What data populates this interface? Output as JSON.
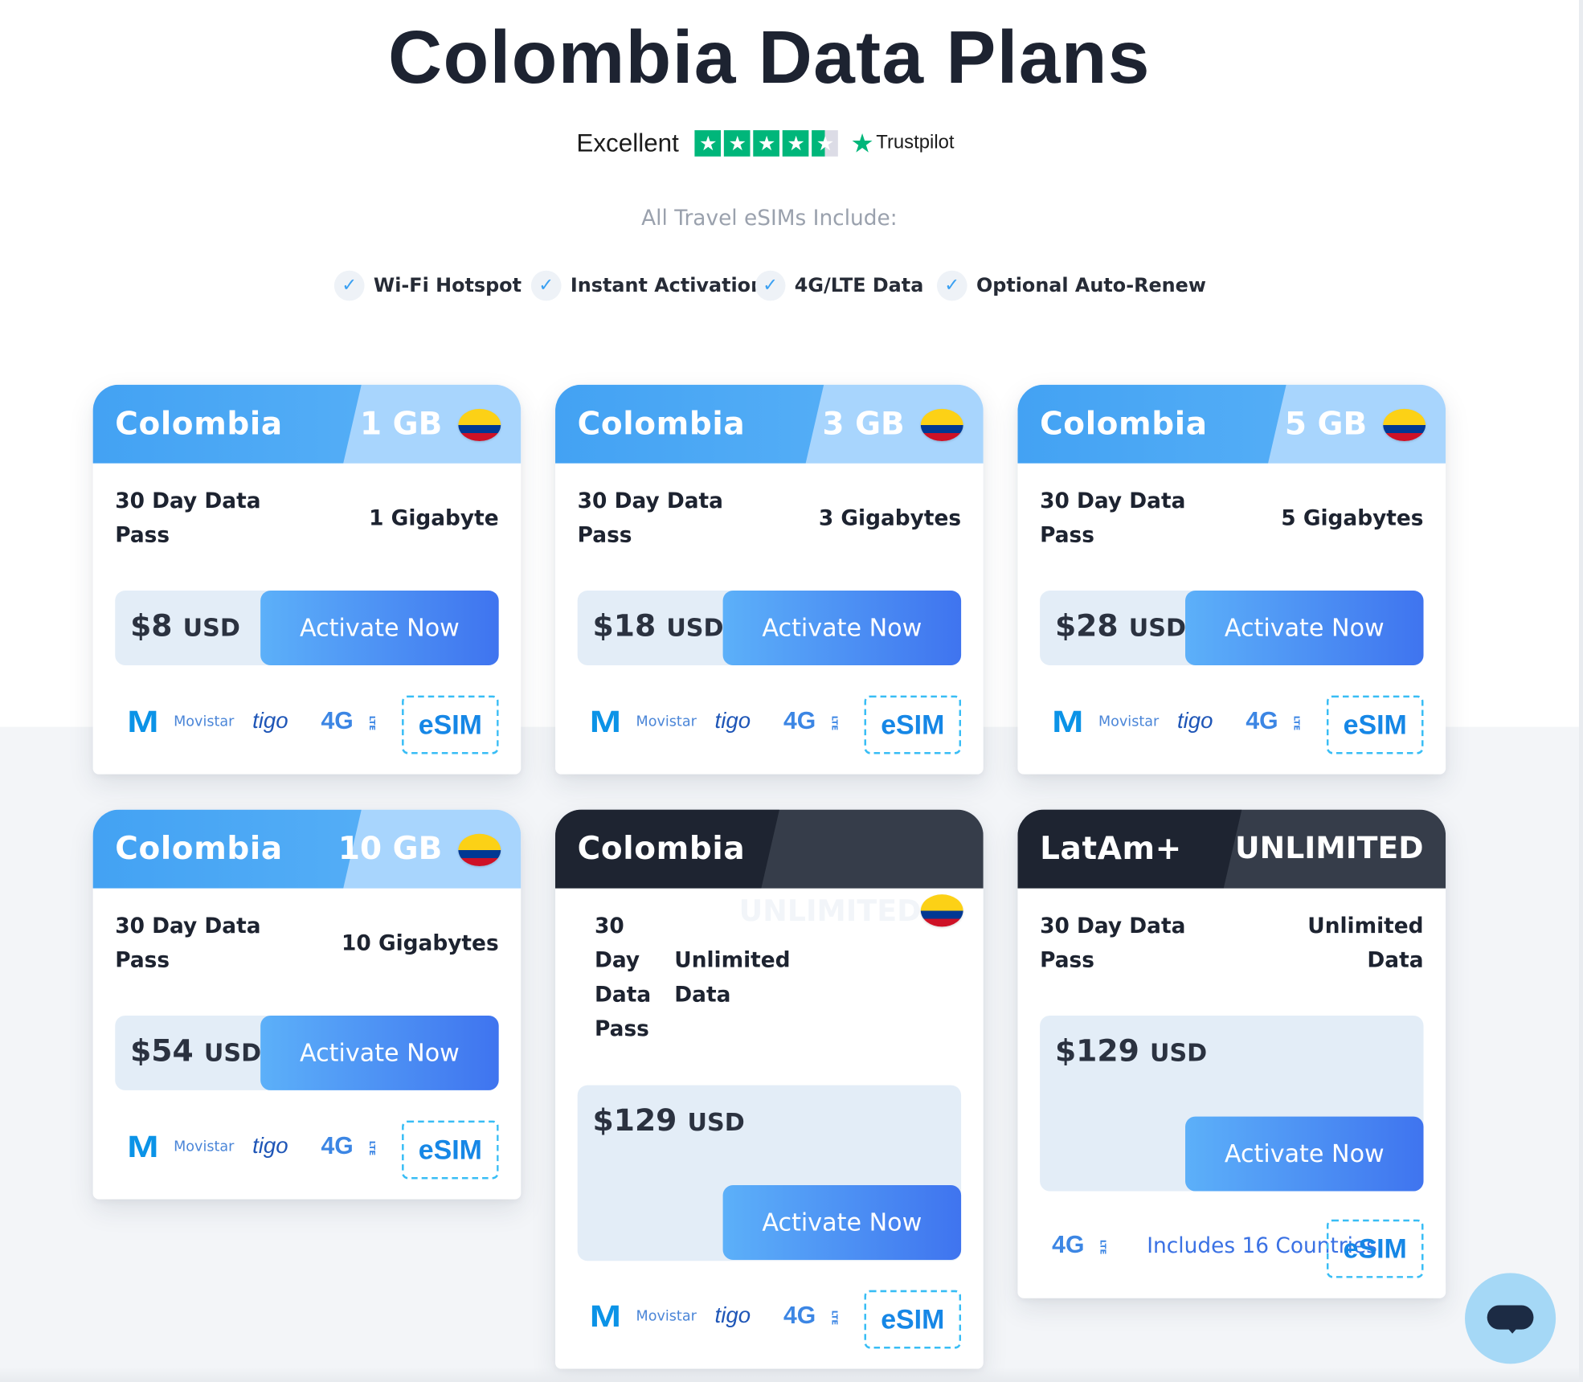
{
  "page": {
    "title": "Colombia Data Plans",
    "rating_label": "Excellent",
    "rating_stars": 4.5,
    "trustpilot": "Trustpilot",
    "includes_heading": "All Travel eSIMs Include:",
    "features": [
      "Wi-Fi Hotspot",
      "Instant Activation",
      "4G/LTE Data",
      "Optional Auto-Renew"
    ]
  },
  "plans": [
    {
      "name": "Colombia",
      "size": "1 GB",
      "duration": "30 Day Data Pass",
      "amount": "1 Gigabyte",
      "price": "$8",
      "currency": "USD",
      "button": "Activate Now"
    },
    {
      "name": "Colombia",
      "size": "3 GB",
      "duration": "30 Day Data Pass",
      "amount": "3 Gigabytes",
      "price": "$18",
      "currency": "USD",
      "button": "Activate Now"
    },
    {
      "name": "Colombia",
      "size": "5 GB",
      "duration": "30 Day Data Pass",
      "amount": "5 Gigabytes",
      "price": "$28",
      "currency": "USD",
      "button": "Activate Now"
    },
    {
      "name": "Colombia",
      "size": "10 GB",
      "duration": "30 Day Data Pass",
      "amount": "10 Gigabytes",
      "price": "$54",
      "currency": "USD",
      "button": "Activate Now"
    },
    {
      "name": "Colombia",
      "size": "UNLIMITED",
      "duration_lines": [
        "30",
        "Day",
        "Data",
        "Pass"
      ],
      "amount_lines": [
        "Unlimited",
        "Data"
      ],
      "price": "$129",
      "currency": "USD",
      "button": "Activate Now"
    },
    {
      "name": "LatAm+",
      "size": "UNLIMITED",
      "duration": "30 Day Data Pass",
      "amount_lines": [
        "Unlimited",
        "Data"
      ],
      "price": "$129",
      "currency": "USD",
      "button": "Activate Now",
      "countries": "Includes 16 Countries"
    }
  ],
  "logos": {
    "movistar_mark": "M",
    "movistar": "Movistar",
    "tigo": "tigo",
    "g4": "4G",
    "lte": "LTE",
    "esim": "eSIM"
  },
  "colors": {
    "accent_blue": "#43a2f3",
    "light_blue": "#a8d5fd",
    "dark": "#1e2431",
    "button_start": "#5cb0f9",
    "button_end": "#3f74ef",
    "trustpilot_green": "#00b67a"
  },
  "icons": {
    "check": "check-icon",
    "star": "star-icon",
    "chat": "chat-icon",
    "flag": "colombia-flag-icon"
  }
}
